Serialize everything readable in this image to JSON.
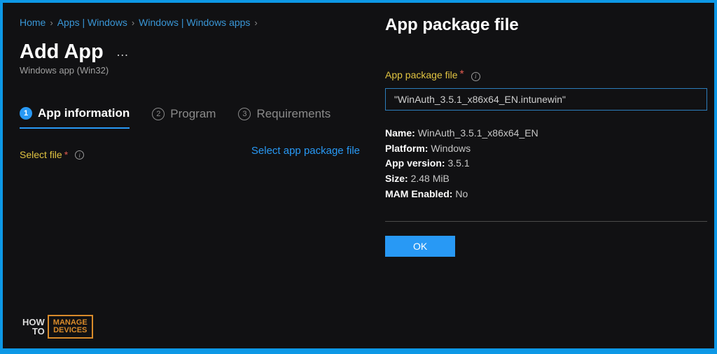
{
  "breadcrumb": {
    "items": [
      "Home",
      "Apps | Windows",
      "Windows | Windows apps"
    ]
  },
  "page": {
    "title": "Add App",
    "subtitle": "Windows app (Win32)",
    "more": "…"
  },
  "tabs": [
    {
      "num": "1",
      "label": "App information"
    },
    {
      "num": "2",
      "label": "Program"
    },
    {
      "num": "3",
      "label": "Requirements"
    }
  ],
  "selectFile": {
    "label": "Select file",
    "link": "Select app package file"
  },
  "panel": {
    "title": "App package file",
    "fieldLabel": "App package file",
    "fileValue": "\"WinAuth_3.5.1_x86x64_EN.intunewin\"",
    "meta": {
      "nameLabel": "Name:",
      "name": "WinAuth_3.5.1_x86x64_EN",
      "platformLabel": "Platform:",
      "platform": "Windows",
      "versionLabel": "App version:",
      "version": "3.5.1",
      "sizeLabel": "Size:",
      "size": "2.48 MiB",
      "mamLabel": "MAM Enabled:",
      "mam": "No"
    },
    "okLabel": "OK"
  },
  "watermark": {
    "left1": "HOW",
    "left2": "TO",
    "right1": "MANAGE",
    "right2": "DEVICES"
  }
}
